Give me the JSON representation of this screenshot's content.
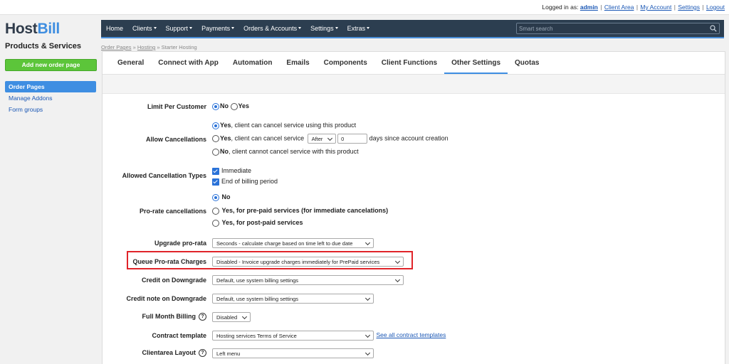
{
  "topbar": {
    "logged_in_as": "Logged in as:",
    "user": "admin",
    "links": [
      "Client Area",
      "My Account",
      "Settings",
      "Logout"
    ]
  },
  "logo": {
    "part1": "Host",
    "part2": "Bill"
  },
  "sidebar": {
    "title": "Products & Services",
    "add_button": "Add new order page",
    "items": [
      {
        "label": "Order Pages",
        "active": true
      },
      {
        "label": "Manage Addons",
        "active": false
      },
      {
        "label": "Form groups",
        "active": false
      }
    ]
  },
  "nav": {
    "items": [
      {
        "label": "Home",
        "dropdown": false
      },
      {
        "label": "Clients",
        "dropdown": true
      },
      {
        "label": "Support",
        "dropdown": true
      },
      {
        "label": "Payments",
        "dropdown": true
      },
      {
        "label": "Orders & Accounts",
        "dropdown": true
      },
      {
        "label": "Settings",
        "dropdown": true
      },
      {
        "label": "Extras",
        "dropdown": true
      }
    ],
    "search_placeholder": "Smart search"
  },
  "breadcrumb": {
    "items": [
      "Order Pages",
      "Hosting"
    ],
    "current": "Starter Hosting"
  },
  "tabs": [
    {
      "label": "General",
      "active": false
    },
    {
      "label": "Connect with App",
      "active": false
    },
    {
      "label": "Automation",
      "active": false
    },
    {
      "label": "Emails",
      "active": false
    },
    {
      "label": "Components",
      "active": false
    },
    {
      "label": "Client Functions",
      "active": false
    },
    {
      "label": "Other Settings",
      "active": true
    },
    {
      "label": "Quotas",
      "active": false
    }
  ],
  "form": {
    "limit_per_customer": {
      "label": "Limit Per Customer",
      "no": "No",
      "yes": "Yes",
      "selected": "No"
    },
    "allow_cancellations": {
      "label": "Allow Cancellations",
      "opt1_bold": "Yes",
      "opt1_rest": ", client can cancel service using this product",
      "opt2_bold": "Yes",
      "opt2_rest": ", client can cancel service",
      "opt2_select": "After",
      "opt2_days": "0",
      "opt2_suffix": "days since account creation",
      "opt3_bold": "No",
      "opt3_rest": ", client cannot cancel service with this product",
      "selected": 1
    },
    "allowed_cancellation_types": {
      "label": "Allowed Cancellation Types",
      "immediate": "Immediate",
      "end_of_billing": "End of billing period"
    },
    "prorate_cancellations": {
      "label": "Pro-rate cancellations",
      "opt1": "No",
      "opt2": "Yes, for pre-paid services (for immediate cancelations)",
      "opt3": "Yes, for post-paid services",
      "selected": 1
    },
    "upgrade_prorata": {
      "label": "Upgrade pro-rata",
      "value": "Seconds - calculate charge based on time left to due date"
    },
    "queue_prorata": {
      "label": "Queue Pro-rata Charges",
      "value": "Disabled - Invoice upgrade charges immediately for PrePaid services"
    },
    "credit_downgrade": {
      "label": "Credit on Downgrade",
      "value": "Default, use system billing settings"
    },
    "credit_note_downgrade": {
      "label": "Credit note on Downgrade",
      "value": "Default, use system billing settings"
    },
    "full_month_billing": {
      "label": "Full Month Billing",
      "help": "?",
      "value": "Disabled"
    },
    "contract_template": {
      "label": "Contract template",
      "value": "Hosting services Terms of Service",
      "link": "See all contract templates"
    },
    "clientarea_layout": {
      "label": "Clientarea Layout",
      "help": "?",
      "value": "Left menu"
    }
  },
  "colors": {
    "nav_bg": "#2c3e50",
    "accent": "#3e8ee2",
    "add_button": "#5cc53a",
    "highlight": "#e0242a"
  }
}
